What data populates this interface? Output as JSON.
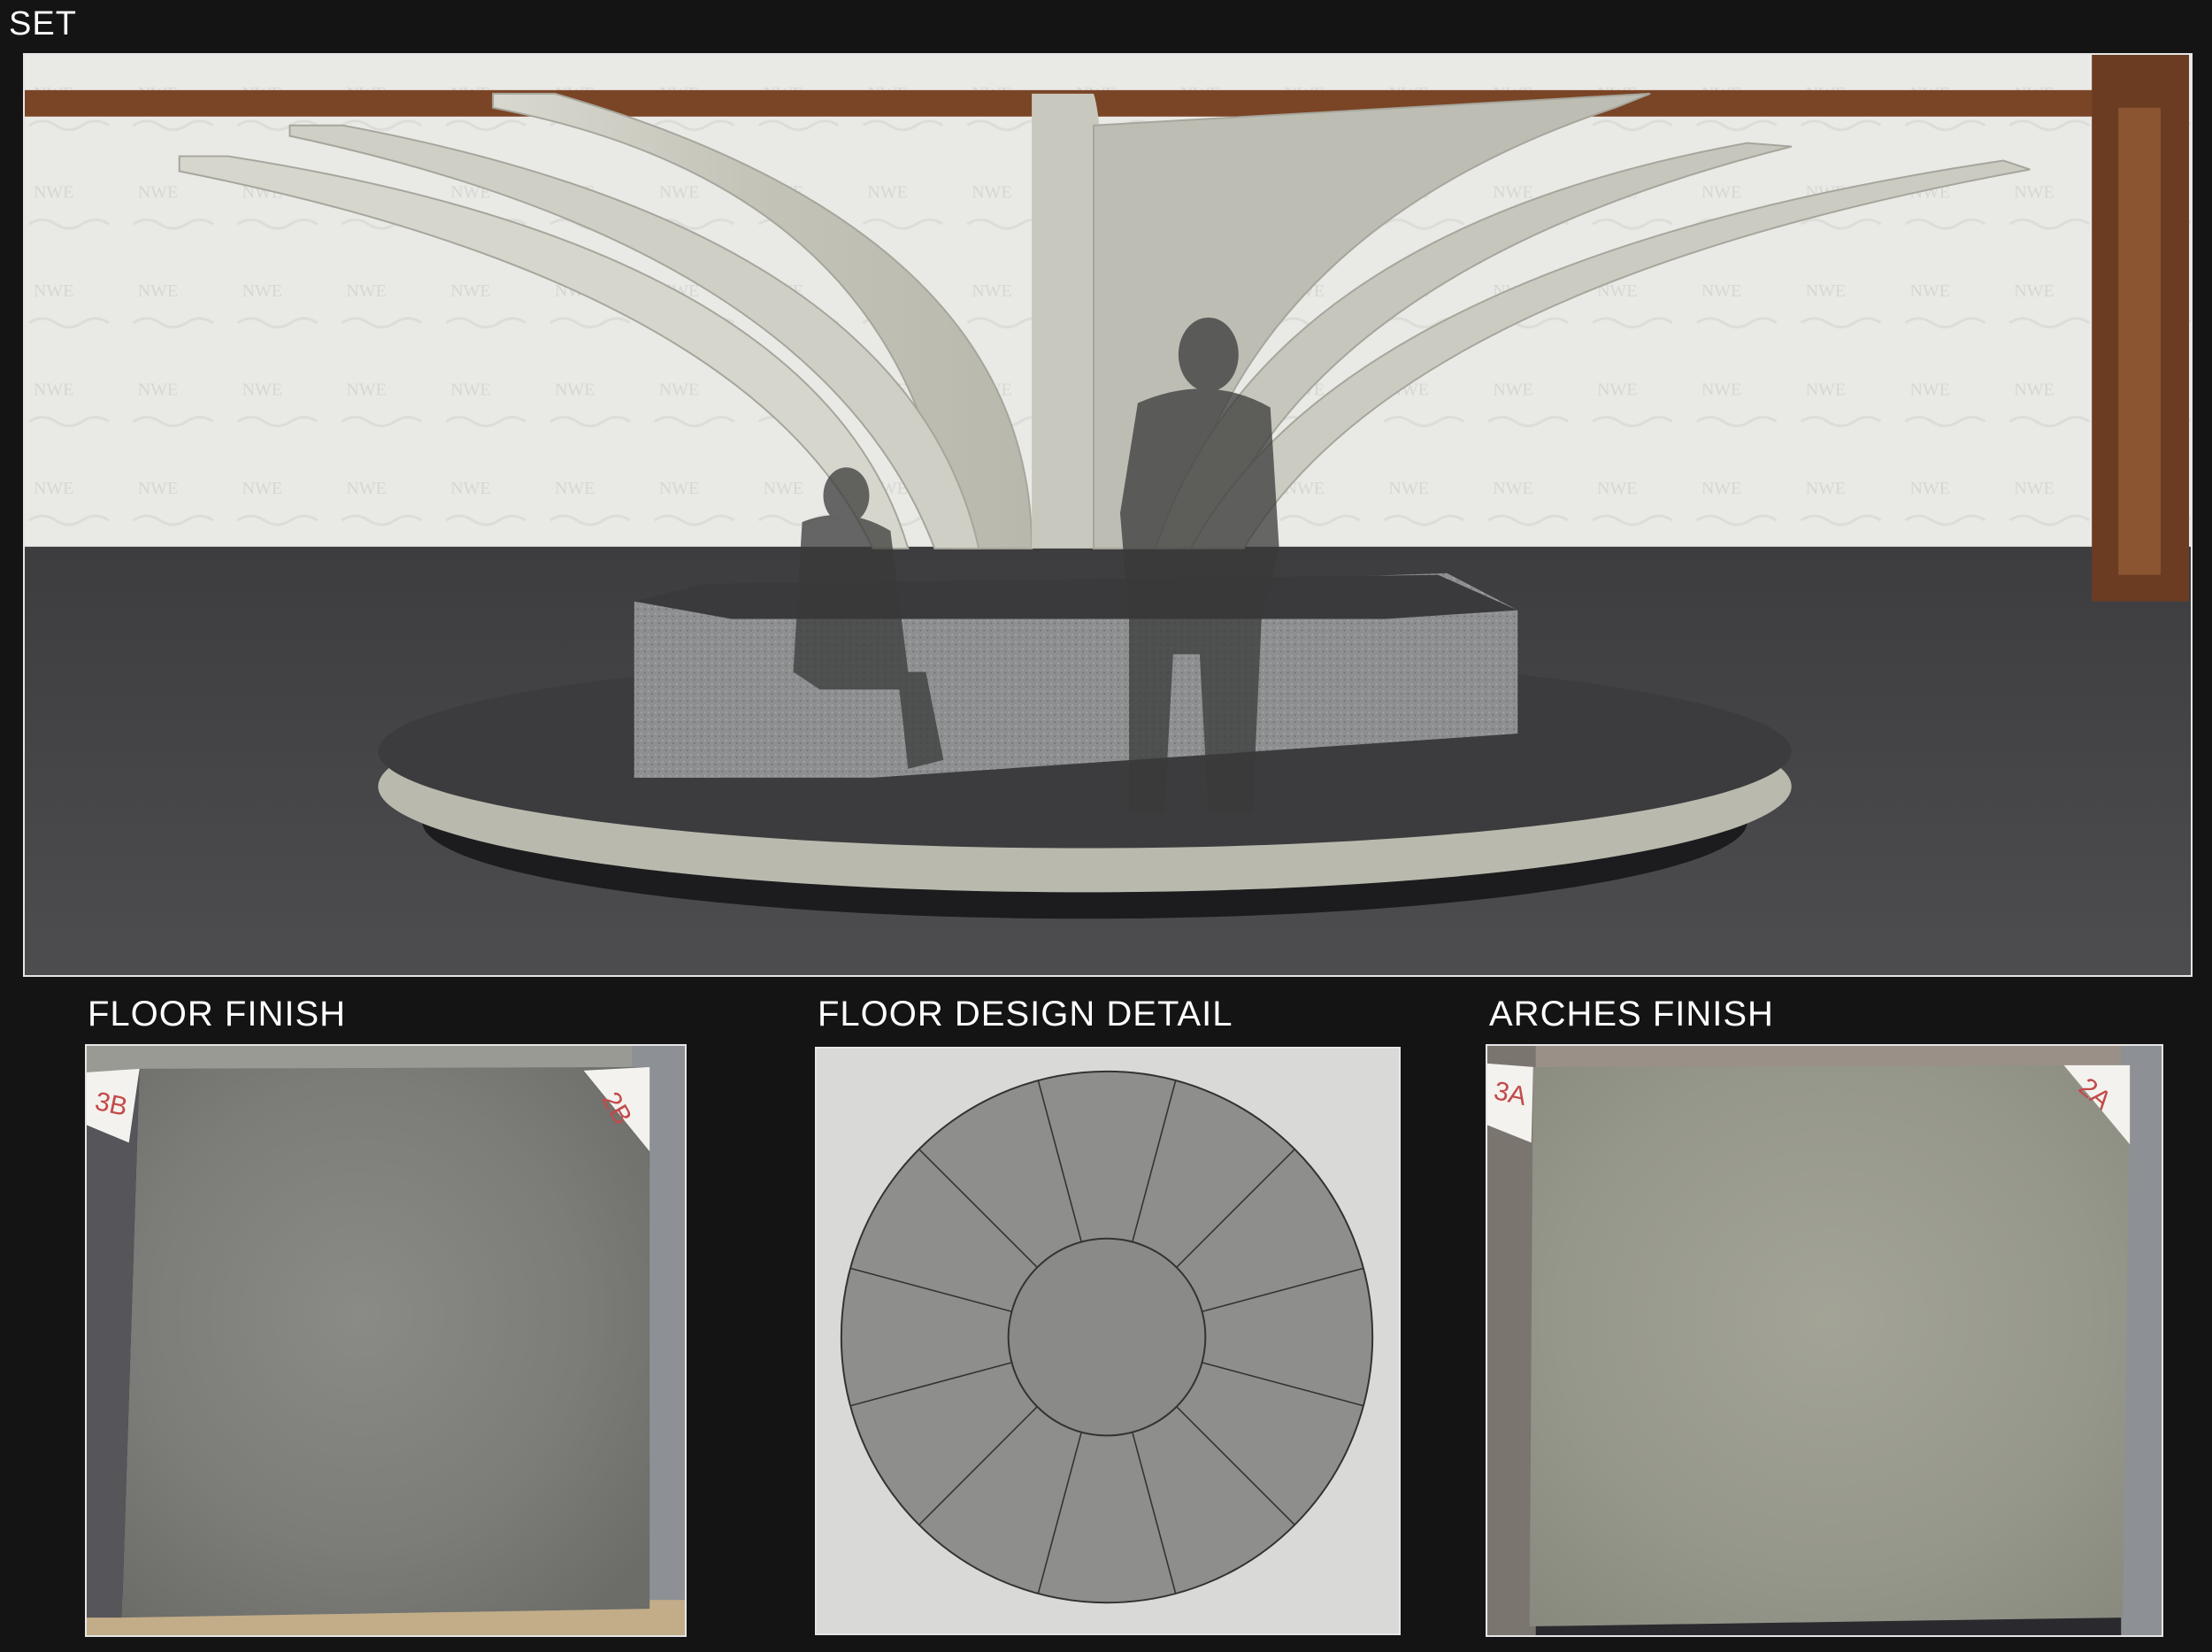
{
  "set": {
    "title": "SET"
  },
  "floor_finish": {
    "title": "FLOOR FINISH",
    "tag_left": "3B",
    "tag_right": "2B"
  },
  "floor_design": {
    "title": "FLOOR DESIGN DETAIL",
    "outer_segments": 12
  },
  "arches_finish": {
    "title": "ARCHES FINISH",
    "tag_left": "3A",
    "tag_right": "2A"
  },
  "colors": {
    "background": "#141414",
    "label_text": "#ffffff",
    "wood_beam": "#7a4526",
    "concrete": "#b9b9ad",
    "stage_floor": "#4a4a4a",
    "tag_ink": "#c24a4a"
  }
}
